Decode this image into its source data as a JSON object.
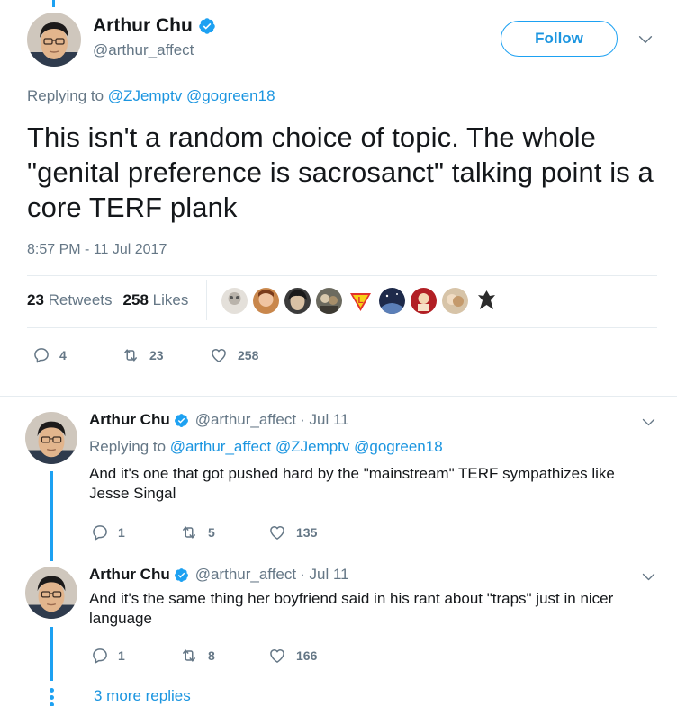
{
  "main_tweet": {
    "name": "Arthur Chu",
    "handle": "@arthur_affect",
    "follow_label": "Follow",
    "replying_prefix": "Replying to",
    "replying_users": [
      "@ZJemptv",
      "@gogreen18"
    ],
    "text": "This isn't a random choice of topic. The whole \"genital preference is sacrosanct\" talking point is a core TERF plank",
    "timestamp": "8:57 PM - 11 Jul 2017",
    "retweets_count": "23",
    "retweets_label": "Retweets",
    "likes_count": "258",
    "likes_label": "Likes",
    "actions": {
      "replies": "4",
      "retweets": "23",
      "likes": "258"
    }
  },
  "replies": [
    {
      "name": "Arthur Chu",
      "handle": "@arthur_affect",
      "date": "· Jul 11",
      "replying_prefix": "Replying to",
      "replying_users": [
        "@arthur_affect",
        "@ZJemptv",
        "@gogreen18"
      ],
      "text": "And it's one that got pushed hard by the \"mainstream\" TERF sympathizes like Jesse Singal",
      "actions": {
        "replies": "1",
        "retweets": "5",
        "likes": "135"
      }
    },
    {
      "name": "Arthur Chu",
      "handle": "@arthur_affect",
      "date": "· Jul 11",
      "text": "And it's the same thing her boyfriend said in his rant about \"traps\" just in nicer language",
      "actions": {
        "replies": "1",
        "retweets": "8",
        "likes": "166"
      }
    }
  ],
  "more_replies_label": "3 more replies",
  "colors": {
    "accent": "#1da1f2",
    "link": "#1b95e0",
    "muted": "#657786",
    "text": "#14171a",
    "divider": "#e6ecf0"
  }
}
